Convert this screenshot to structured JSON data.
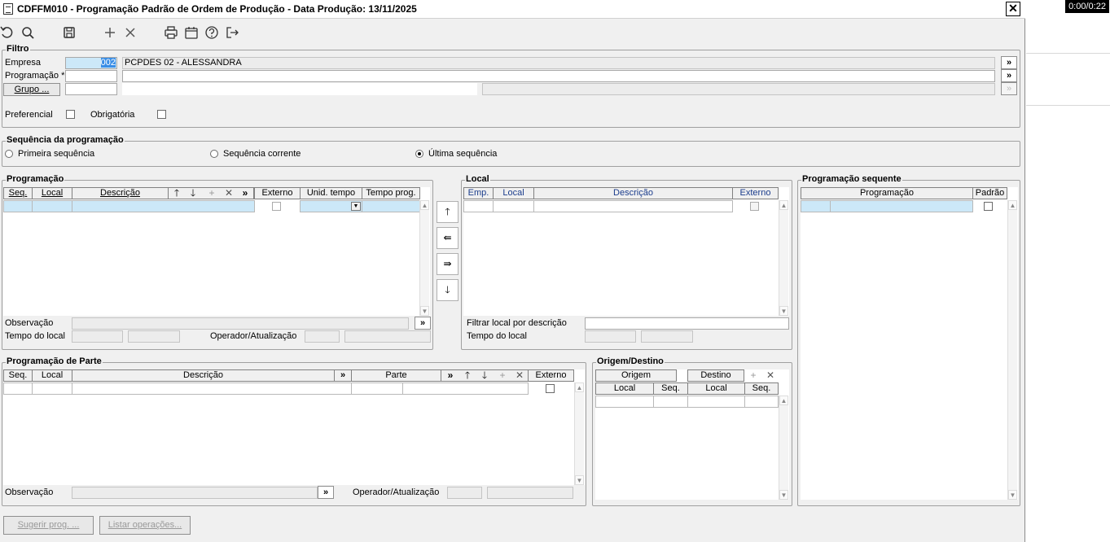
{
  "window": {
    "title": "CDFFM010 - Programação Padrão de Ordem de Produção - Data Produção: 13/11/2025",
    "close_label": "✕"
  },
  "overlay": {
    "timer": "0:00/0:22"
  },
  "toolbar": {
    "icons": [
      "undo-icon",
      "search-icon",
      "save-icon",
      "add-icon",
      "delete-icon",
      "print-icon",
      "calendar-icon",
      "help-icon",
      "exit-icon"
    ]
  },
  "filtro": {
    "legend": "Filtro",
    "empresa_label": "Empresa",
    "empresa_code": "002",
    "empresa_desc": "PCPDES 02 - ALESSANDRA",
    "programacao_label": "Programação *",
    "grupo_button": "Grupo ...",
    "preferencial_label": "Preferencial",
    "obrigatoria_label": "Obrigatória",
    "more_label": "»"
  },
  "sequencia": {
    "legend": "Sequência da programação",
    "options": [
      "Primeira sequência",
      "Sequência corrente",
      "Última sequência"
    ],
    "selected": "Última sequência"
  },
  "programacao": {
    "legend": "Programação",
    "columns": {
      "seq": "Seq.",
      "local": "Local",
      "descricao": "Descrição",
      "externo": "Externo",
      "unid_tempo": "Unid. tempo",
      "tempo_prog": "Tempo prog.",
      "more": "»"
    },
    "observacao_label": "Observação",
    "tempo_local_label": "Tempo do local",
    "operador_label": "Operador/Atualização"
  },
  "local": {
    "legend": "Local",
    "columns": {
      "emp": "Emp.",
      "local": "Local",
      "descricao": "Descrição",
      "externo": "Externo"
    },
    "filtrar_label": "Filtrar local por descrição",
    "tempo_local_label": "Tempo do local"
  },
  "prog_sequente": {
    "legend": "Programação sequente",
    "columns": {
      "programacao": "Programação",
      "padrao": "Padrão"
    }
  },
  "prog_parte": {
    "legend": "Programação de Parte",
    "columns": {
      "seq": "Seq.",
      "local": "Local",
      "descricao": "Descrição",
      "parte": "Parte",
      "externo": "Externo",
      "more": "»"
    },
    "observacao_label": "Observação",
    "operador_label": "Operador/Atualização"
  },
  "origem_destino": {
    "legend": "Origem/Destino",
    "origem": "Origem",
    "destino": "Destino",
    "sub_columns": {
      "local": "Local",
      "seq": "Seq."
    }
  },
  "footer": {
    "sugerir_button": "Sugerir prog. ...",
    "listar_button": "Listar operações..."
  }
}
